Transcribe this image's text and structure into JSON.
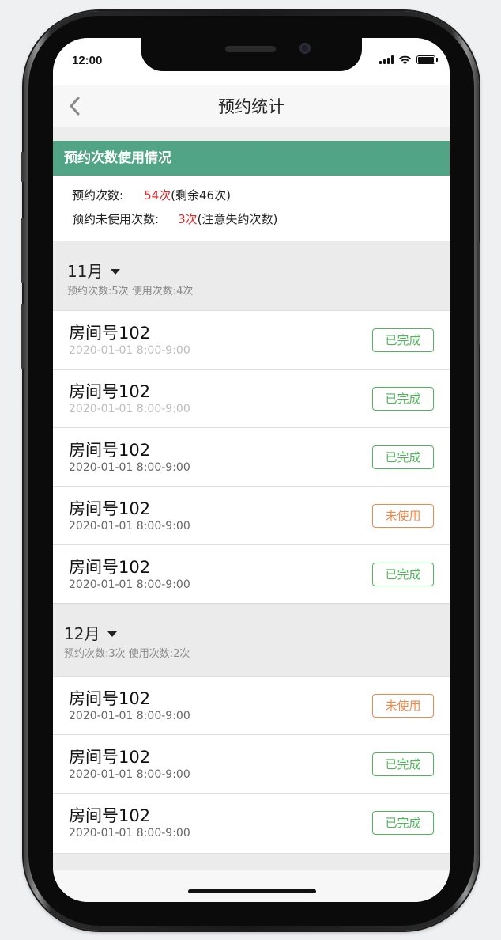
{
  "status_bar": {
    "time": "12:00"
  },
  "nav": {
    "title": "预约统计",
    "back_icon": "chevron-left-icon"
  },
  "summary": {
    "header": "预约次数使用情况",
    "booked_label": "预约次数:",
    "booked_value": "54次",
    "booked_note": "(剩余46次)",
    "unused_label": "预约未使用次数:",
    "unused_value": "3次",
    "unused_note": "(注意失约次数)"
  },
  "months": [
    {
      "title": "11月",
      "stats": "预约次数:5次   使用次数:4次",
      "items": [
        {
          "room": "房间号102",
          "time": "2020-01-01 8:00-9:00",
          "status": "已完成"
        },
        {
          "room": "房间号102",
          "time": "2020-01-01 8:00-9:00",
          "status": "已完成"
        },
        {
          "room": "房间号102",
          "time": "2020-01-01 8:00-9:00",
          "status": "已完成"
        },
        {
          "room": "房间号102",
          "time": "2020-01-01 8:00-9:00",
          "status": "未使用"
        },
        {
          "room": "房间号102",
          "time": "2020-01-01 8:00-9:00",
          "status": "已完成"
        }
      ]
    },
    {
      "title": "12月",
      "stats": "预约次数:3次   使用次数:2次",
      "items": [
        {
          "room": "房间号102",
          "time": "2020-01-01 8:00-9:00",
          "status": "未使用"
        },
        {
          "room": "房间号102",
          "time": "2020-01-01 8:00-9:00",
          "status": "已完成"
        },
        {
          "room": "房间号102",
          "time": "2020-01-01 8:00-9:00",
          "status": "已完成"
        }
      ]
    }
  ],
  "colors": {
    "header_green": "#52a486",
    "completed_green": "#4fb45a",
    "unused_orange": "#ec8a4a",
    "accent_red": "#e02a2a"
  }
}
